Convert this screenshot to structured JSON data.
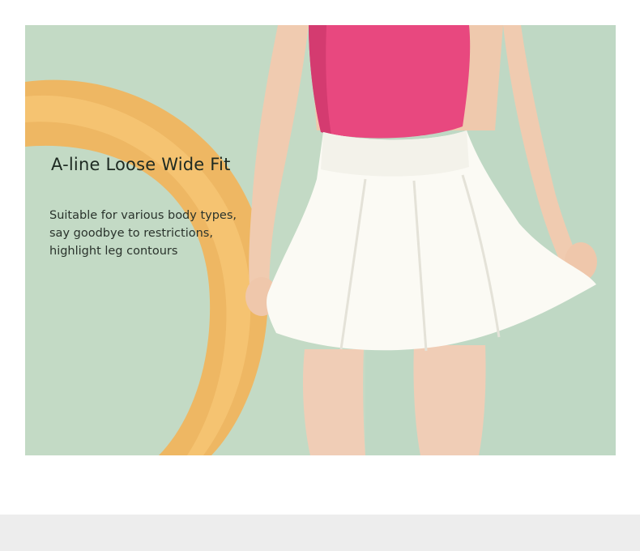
{
  "product_banner": {
    "headline": "A-line Loose Wide Fit",
    "description_lines": [
      "Suitable for various body types,",
      "say goodbye to restrictions,",
      "highlight leg contours"
    ]
  },
  "colors": {
    "background_green": "#bcd6bf",
    "ring_orange": "#f2b45a",
    "top_pink": "#e8487f",
    "skirt_white": "#fbfaf4",
    "skin": "#efcbb3"
  }
}
